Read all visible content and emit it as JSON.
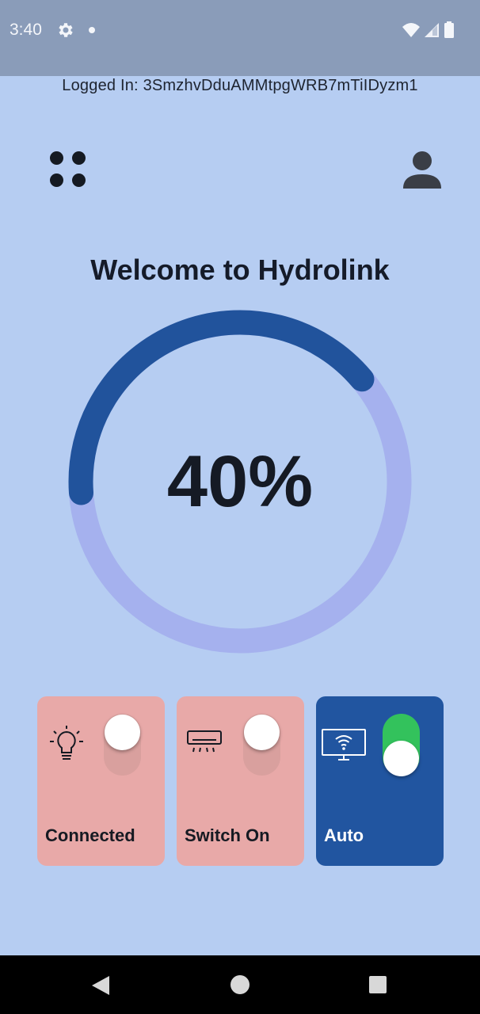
{
  "status_bar": {
    "time": "3:40",
    "icons": [
      "gear-icon",
      "notification-dot",
      "wifi-icon",
      "signal-icon",
      "battery-icon"
    ]
  },
  "header": {
    "logged_in": "Logged In: 3SmzhvDduAMMtpgWRB7mTiIDyzm1",
    "menu_icon": "grid-menu-icon",
    "profile_icon": "user-icon"
  },
  "main": {
    "welcome": "Welcome to Hydrolink",
    "gauge": {
      "label": "40%",
      "value": 0.4,
      "track_color": "#a5b1ee",
      "fill_color": "#21539c"
    }
  },
  "cards": [
    {
      "label": "Connected",
      "icon": "lightbulb-icon",
      "state": "off",
      "bg": "#e8a9a8"
    },
    {
      "label": "Switch On",
      "icon": "air-conditioner-icon",
      "state": "off",
      "bg": "#e8a9a8"
    },
    {
      "label": "Auto",
      "icon": "wifi-monitor-icon",
      "state": "on",
      "bg": "#2155a0"
    }
  ],
  "nav_bar": {
    "buttons": [
      "back-icon",
      "home-icon",
      "recents-icon"
    ]
  }
}
